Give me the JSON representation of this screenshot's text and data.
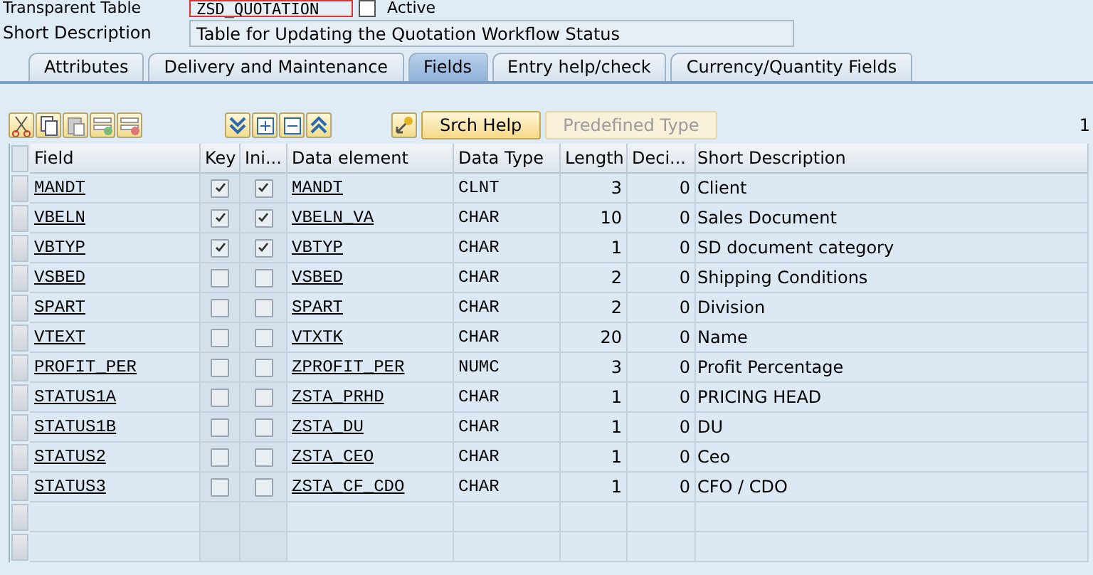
{
  "header": {
    "table_type_label": "Transparent Table",
    "table_name": "ZSD_QUOTATION",
    "status": "Active",
    "short_description_label": "Short Description",
    "short_description": "Table for Updating the Quotation Workflow Status"
  },
  "tabs": [
    {
      "label": "Attributes",
      "selected": false
    },
    {
      "label": "Delivery and Maintenance",
      "selected": false
    },
    {
      "label": "Fields",
      "selected": true
    },
    {
      "label": "Entry help/check",
      "selected": false
    },
    {
      "label": "Currency/Quantity Fields",
      "selected": false
    }
  ],
  "toolbar": {
    "buttons": [
      {
        "label": "Srch Help",
        "disabled": false
      },
      {
        "label": "Predefined Type",
        "disabled": true
      }
    ],
    "counter": "1"
  },
  "table": {
    "columns": [
      "Field",
      "Key",
      "Ini...",
      "Data element",
      "Data Type",
      "Length",
      "Deci...",
      "Short Description"
    ],
    "rows": [
      {
        "field": "MANDT",
        "key": true,
        "initial": true,
        "data_element": "MANDT",
        "data_type": "CLNT",
        "length": "3",
        "decimals": "0",
        "description": "Client"
      },
      {
        "field": "VBELN",
        "key": true,
        "initial": true,
        "data_element": "VBELN_VA",
        "data_type": "CHAR",
        "length": "10",
        "decimals": "0",
        "description": "Sales Document"
      },
      {
        "field": "VBTYP",
        "key": true,
        "initial": true,
        "data_element": "VBTYP",
        "data_type": "CHAR",
        "length": "1",
        "decimals": "0",
        "description": "SD document category"
      },
      {
        "field": "VSBED",
        "key": false,
        "initial": false,
        "data_element": "VSBED",
        "data_type": "CHAR",
        "length": "2",
        "decimals": "0",
        "description": "Shipping Conditions"
      },
      {
        "field": "SPART",
        "key": false,
        "initial": false,
        "data_element": "SPART",
        "data_type": "CHAR",
        "length": "2",
        "decimals": "0",
        "description": "Division"
      },
      {
        "field": "VTEXT",
        "key": false,
        "initial": false,
        "data_element": "VTXTK",
        "data_type": "CHAR",
        "length": "20",
        "decimals": "0",
        "description": "Name"
      },
      {
        "field": "PROFIT_PER",
        "key": false,
        "initial": false,
        "data_element": "ZPROFIT_PER",
        "data_type": "NUMC",
        "length": "3",
        "decimals": "0",
        "description": "Profit Percentage"
      },
      {
        "field": "STATUS1A",
        "key": false,
        "initial": false,
        "data_element": "ZSTA_PRHD",
        "data_type": "CHAR",
        "length": "1",
        "decimals": "0",
        "description": "PRICING HEAD"
      },
      {
        "field": "STATUS1B",
        "key": false,
        "initial": false,
        "data_element": "ZSTA_DU",
        "data_type": "CHAR",
        "length": "1",
        "decimals": "0",
        "description": "DU"
      },
      {
        "field": "STATUS2",
        "key": false,
        "initial": false,
        "data_element": "ZSTA_CEO",
        "data_type": "CHAR",
        "length": "1",
        "decimals": "0",
        "description": "Ceo"
      },
      {
        "field": "STATUS3",
        "key": false,
        "initial": false,
        "data_element": "ZSTA_CF_CDO",
        "data_type": "CHAR",
        "length": "1",
        "decimals": "0",
        "description": "CFO / CDO"
      }
    ]
  }
}
